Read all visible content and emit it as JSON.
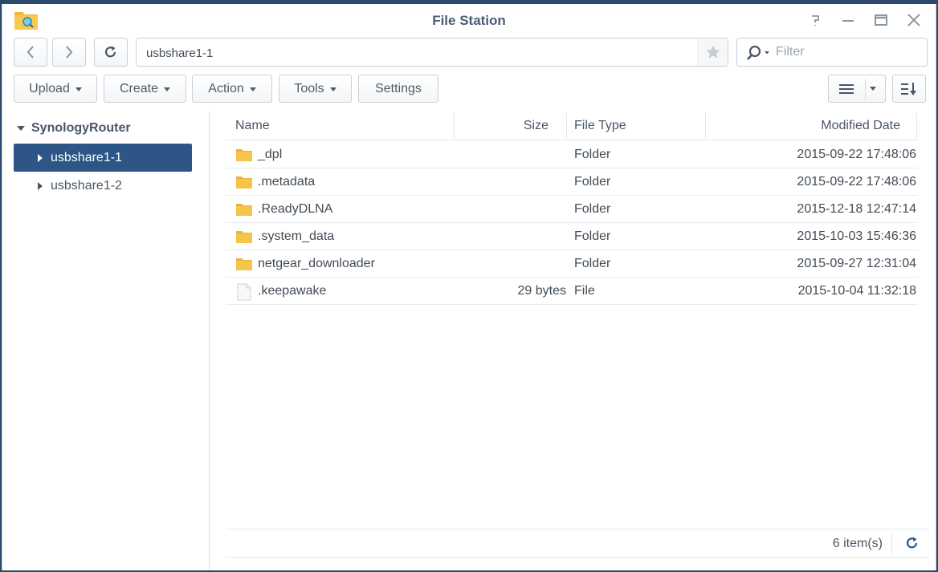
{
  "window": {
    "title": "File Station"
  },
  "nav": {
    "path": "usbshare1-1",
    "filter_placeholder": "Filter"
  },
  "toolbar": {
    "upload": "Upload",
    "create": "Create",
    "action": "Action",
    "tools": "Tools",
    "settings": "Settings"
  },
  "tree": {
    "root": "SynologyRouter",
    "items": [
      {
        "label": "usbshare1-1",
        "selected": true
      },
      {
        "label": "usbshare1-2",
        "selected": false
      }
    ]
  },
  "list": {
    "columns": {
      "name": "Name",
      "size": "Size",
      "type": "File Type",
      "modified": "Modified Date"
    },
    "rows": [
      {
        "name": "_dpl",
        "size": "",
        "type": "Folder",
        "modified": "2015-09-22 17:48:06",
        "icon": "folder-icon"
      },
      {
        "name": ".metadata",
        "size": "",
        "type": "Folder",
        "modified": "2015-09-22 17:48:06",
        "icon": "folder-icon"
      },
      {
        "name": ".ReadyDLNA",
        "size": "",
        "type": "Folder",
        "modified": "2015-12-18 12:47:14",
        "icon": "folder-icon"
      },
      {
        "name": ".system_data",
        "size": "",
        "type": "Folder",
        "modified": "2015-10-03 15:46:36",
        "icon": "folder-icon"
      },
      {
        "name": "netgear_downloader",
        "size": "",
        "type": "Folder",
        "modified": "2015-09-27 12:31:04",
        "icon": "folder-icon"
      },
      {
        "name": ".keepawake",
        "size": "29 bytes",
        "type": "File",
        "modified": "2015-10-04 11:32:18",
        "icon": "file-icon"
      }
    ]
  },
  "footer": {
    "count": "6 item(s)"
  },
  "colors": {
    "selection": "#2d5586",
    "folder": "#f5c54a",
    "title_text": "#4a5c73"
  }
}
